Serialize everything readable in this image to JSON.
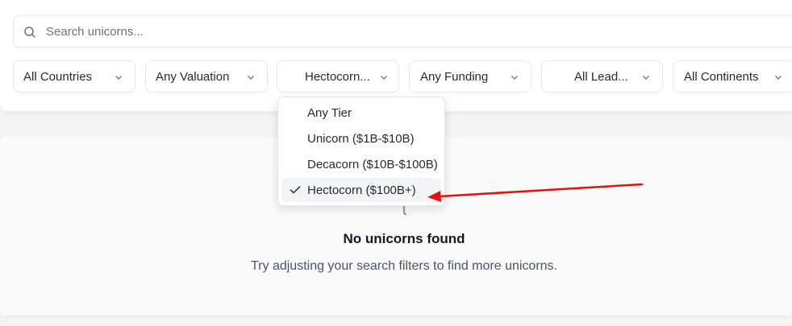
{
  "search": {
    "placeholder": "Search unicorns..."
  },
  "filters": [
    {
      "label": "All Countries"
    },
    {
      "label": "Any Valuation"
    },
    {
      "label": "Hectocorn..."
    },
    {
      "label": "Any Funding"
    },
    {
      "label": "All Lead..."
    },
    {
      "label": "All Continents"
    }
  ],
  "tier_dropdown": {
    "options": [
      {
        "label": "Any Tier"
      },
      {
        "label": "Unicorn ($1B-$10B)"
      },
      {
        "label": "Decacorn ($10B-$100B)"
      },
      {
        "label": "Hectocorn ($100B+)"
      }
    ],
    "selected": "Hectocorn ($100B+)"
  },
  "empty_state": {
    "title": "No unicorns found",
    "subtitle": "Try adjusting your search filters to find more unicorns."
  },
  "icons": {
    "search": "search-icon",
    "chevron": "chevron-down-icon",
    "check": "check-icon",
    "empty": "empty-state-icon"
  },
  "colors": {
    "annotation_arrow": "#e8100c",
    "border": "#e5e7eb",
    "selected_bg": "#f3f4f6"
  }
}
